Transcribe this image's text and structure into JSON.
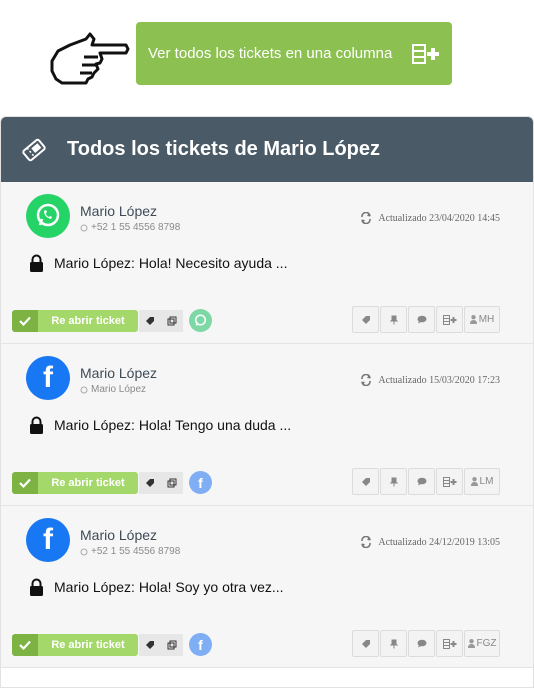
{
  "top": {
    "view_all_label": "Ver todos los tickets en una columna",
    "hand_icon": "pointing-hand-icon",
    "columns_icon": "add-column-icon"
  },
  "panel": {
    "title": "Todos los tickets de Mario López",
    "icon": "ticket-icon"
  },
  "tickets": [
    {
      "channel": "whatsapp",
      "name": "Mario López",
      "sub": "+52 1 55 4556 8798",
      "updated": "Actualizado 23/04/2020 14:45",
      "message": "Mario López: Hola! Necesito ayuda ...",
      "reopen_label": "Re abrir ticket",
      "agent": "MH"
    },
    {
      "channel": "facebook",
      "name": "Mario López",
      "sub": "Mario López",
      "updated": "Actualizado 15/03/2020 17:23",
      "message": "Mario López: Hola! Tengo una duda ...",
      "reopen_label": "Re abrir ticket",
      "agent": "LM"
    },
    {
      "channel": "facebook",
      "name": "Mario López",
      "sub": "+52 1 55 4556 8798",
      "updated": "Actualizado 24/12/2019 13:05",
      "message": "Mario López: Hola! Soy yo otra vez...",
      "reopen_label": "Re abrir ticket",
      "agent": "FGZ"
    }
  ],
  "colors": {
    "accent_green": "#8cc152",
    "header_bg": "#4a5a66",
    "whatsapp": "#25d366",
    "facebook": "#1877f2"
  }
}
